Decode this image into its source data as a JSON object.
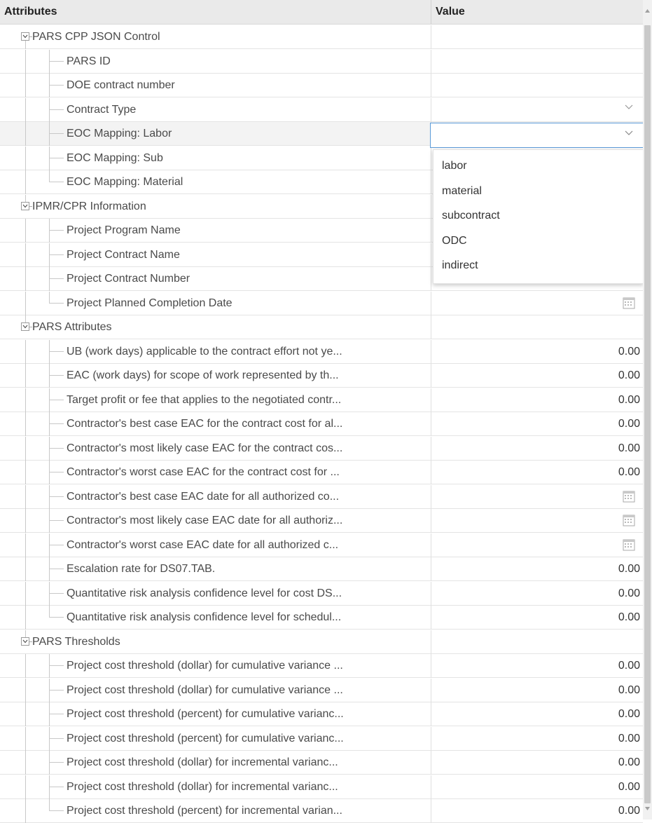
{
  "columns": {
    "attributes": "Attributes",
    "value": "Value"
  },
  "rows": [
    {
      "level": 0,
      "label": "PARS CPP JSON Control",
      "kind": "group"
    },
    {
      "level": 1,
      "label": "PARS ID",
      "kind": "text",
      "value": ""
    },
    {
      "level": 1,
      "label": "DOE contract number",
      "kind": "text",
      "value": ""
    },
    {
      "level": 1,
      "label": "Contract Type",
      "kind": "select",
      "value": ""
    },
    {
      "level": 1,
      "label": "EOC Mapping: Labor",
      "kind": "select-open",
      "value": "",
      "selected": true
    },
    {
      "level": 1,
      "label": "EOC Mapping: Sub",
      "kind": "select",
      "value": ""
    },
    {
      "level": 1,
      "label": "EOC Mapping: Material",
      "kind": "select",
      "value": ""
    },
    {
      "level": 0,
      "label": "IPMR/CPR Information",
      "kind": "group"
    },
    {
      "level": 1,
      "label": "Project Program Name",
      "kind": "text",
      "value": ""
    },
    {
      "level": 1,
      "label": "Project Contract Name",
      "kind": "text",
      "value": ""
    },
    {
      "level": 1,
      "label": "Project Contract Number",
      "kind": "text",
      "value": ""
    },
    {
      "level": 1,
      "label": "Project Planned Completion Date",
      "kind": "date",
      "value": ""
    },
    {
      "level": 0,
      "label": "PARS Attributes",
      "kind": "group"
    },
    {
      "level": 1,
      "label": "UB (work days) applicable to the contract effort not ye...",
      "kind": "number",
      "value": "0.00"
    },
    {
      "level": 1,
      "label": "EAC (work days) for scope of work represented by th...",
      "kind": "number",
      "value": "0.00"
    },
    {
      "level": 1,
      "label": "Target profit or fee that applies to the negotiated contr...",
      "kind": "number",
      "value": "0.00"
    },
    {
      "level": 1,
      "label": "Contractor's best case EAC for the contract cost for al...",
      "kind": "number",
      "value": "0.00"
    },
    {
      "level": 1,
      "label": "Contractor's most likely case EAC for the contract cos...",
      "kind": "number",
      "value": "0.00"
    },
    {
      "level": 1,
      "label": "Contractor's worst case EAC for the contract cost for ...",
      "kind": "number",
      "value": "0.00"
    },
    {
      "level": 1,
      "label": "Contractor's best case EAC date for all authorized co...",
      "kind": "date",
      "value": ""
    },
    {
      "level": 1,
      "label": "Contractor's most likely case EAC date for all authoriz...",
      "kind": "date",
      "value": ""
    },
    {
      "level": 1,
      "label": "Contractor's worst case EAC date for all authorized c...",
      "kind": "date",
      "value": ""
    },
    {
      "level": 1,
      "label": "Escalation rate for DS07.TAB.",
      "kind": "number",
      "value": "0.00"
    },
    {
      "level": 1,
      "label": "Quantitative risk analysis confidence level for cost DS...",
      "kind": "number",
      "value": "0.00"
    },
    {
      "level": 1,
      "label": "Quantitative risk analysis confidence level for schedul...",
      "kind": "number",
      "value": "0.00"
    },
    {
      "level": 0,
      "label": "PARS Thresholds",
      "kind": "group"
    },
    {
      "level": 1,
      "label": "Project cost threshold (dollar) for cumulative variance ...",
      "kind": "number",
      "value": "0.00"
    },
    {
      "level": 1,
      "label": "Project cost threshold (dollar) for cumulative variance ...",
      "kind": "number",
      "value": "0.00"
    },
    {
      "level": 1,
      "label": "Project cost threshold (percent) for cumulative varianc...",
      "kind": "number",
      "value": "0.00"
    },
    {
      "level": 1,
      "label": "Project cost threshold (percent) for cumulative varianc...",
      "kind": "number",
      "value": "0.00"
    },
    {
      "level": 1,
      "label": "Project cost threshold (dollar) for incremental varianc...",
      "kind": "number",
      "value": "0.00"
    },
    {
      "level": 1,
      "label": "Project cost threshold (dollar) for incremental varianc...",
      "kind": "number",
      "value": "0.00"
    },
    {
      "level": 1,
      "label": "Project cost threshold (percent) for incremental varian...",
      "kind": "number",
      "value": "0.00"
    }
  ],
  "dropdown": {
    "options": [
      "labor",
      "material",
      "subcontract",
      "ODC",
      "indirect"
    ]
  },
  "colors": {
    "focus_border": "#5a9ad8",
    "header_bg": "#eaeaea",
    "selected_row_bg": "#f3f3f3"
  },
  "icons": {
    "expand": "minus-toggle-icon",
    "select": "chevron-down-icon",
    "date": "calendar-icon",
    "scroll_up": "scroll-up-icon",
    "scroll_down": "scroll-down-icon"
  }
}
